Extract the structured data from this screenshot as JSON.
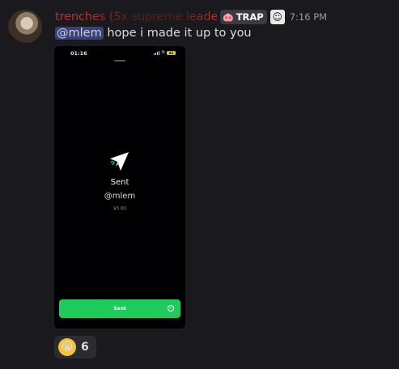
{
  "message": {
    "author": {
      "display_name": "trenches (5x supreme leader",
      "avatar_icon": "avatar",
      "tag": {
        "icon": "pig-face-icon",
        "label": "TRAP"
      },
      "badge_icon": "trollface-icon"
    },
    "timestamp": "7:16 PM",
    "mention": "@mlem",
    "text": "hope i made it up to you",
    "attachment": {
      "status_time": "01:16",
      "battery_level": "41",
      "title": "Sent",
      "recipient": "@mlem",
      "amount": "$5.00",
      "button_label": "Sent",
      "accent_color": "#1fcb5a"
    },
    "reactions": [
      {
        "emoji": "😭",
        "count": "6"
      }
    ]
  }
}
